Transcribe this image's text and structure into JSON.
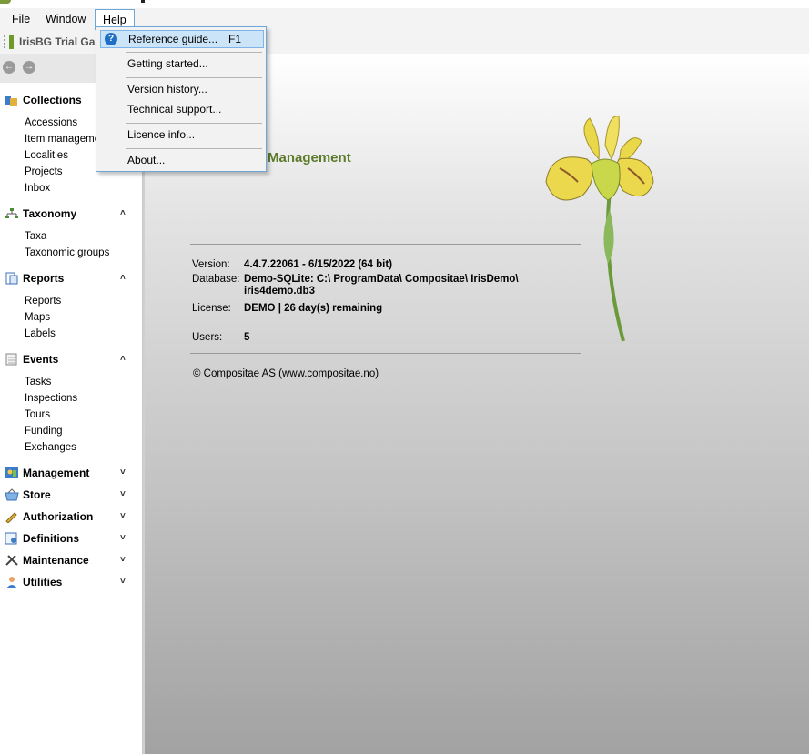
{
  "toolbar": {
    "title": "IrisBG Trial Ga"
  },
  "menubar": {
    "file": "File",
    "window": "Window",
    "help": "Help"
  },
  "help_menu": {
    "reference_guide": "Reference guide...",
    "reference_guide_shortcut": "F1",
    "getting_started": "Getting started...",
    "version_history": "Version history...",
    "technical_support": "Technical support...",
    "licence_info": "Licence info...",
    "about": "About..."
  },
  "sidebar": {
    "collections": {
      "label": "Collections",
      "items": [
        "Accessions",
        "Item manageme",
        "Localities",
        "Projects",
        "Inbox"
      ]
    },
    "taxonomy": {
      "label": "Taxonomy",
      "items": [
        "Taxa",
        "Taxonomic groups"
      ]
    },
    "reports": {
      "label": "Reports",
      "items": [
        "Reports",
        "Maps",
        "Labels"
      ]
    },
    "events": {
      "label": "Events",
      "items": [
        "Tasks",
        "Inspections",
        "Tours",
        "Funding",
        "Exchanges"
      ]
    },
    "management": {
      "label": "Management"
    },
    "store": {
      "label": "Store"
    },
    "authorization": {
      "label": "Authorization"
    },
    "definitions": {
      "label": "Definitions"
    },
    "maintenance": {
      "label": "Maintenance"
    },
    "utilities": {
      "label": "Utilities"
    },
    "chevron_up": "˄",
    "chevron_down": "˅"
  },
  "main": {
    "app_title": "Management",
    "version_label": "Version:",
    "version_value": "4.4.7.22061 - 6/15/2022  (64 bit)",
    "database_label": "Database:",
    "database_value_1": "Demo-SQLite: C:\\ ProgramData\\ Compositae\\ IrisDemo\\",
    "database_value_2": "iris4demo.db3",
    "license_label": "License:",
    "license_value": "DEMO | 26 day(s) remaining",
    "users_label": "Users:",
    "users_value": "5",
    "copyright": "© Compositae AS (www.compositae.no)"
  },
  "colors": {
    "accent_green": "#5c7a2a",
    "selection_blue": "#cce4f7",
    "help_icon_blue": "#1f6fc4"
  }
}
